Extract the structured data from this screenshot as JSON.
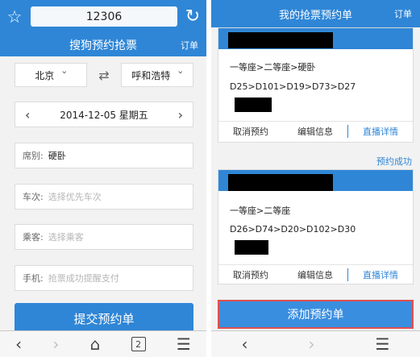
{
  "left": {
    "url": "12306",
    "title": "搜狗预约抢票",
    "title_side": "订单",
    "from_city": "北京",
    "to_city": "呼和浩特",
    "date": "2014-12-05 星期五",
    "fields": {
      "seat_label": "席别:",
      "seat_value": "硬卧",
      "train_label": "车次:",
      "train_placeholder": "选择优先车次",
      "passenger_label": "乘客:",
      "passenger_placeholder": "选择乘客",
      "phone_label": "手机:",
      "phone_placeholder": "抢票成功提醒支付"
    },
    "submit_label": "提交预约单",
    "tab_count": "2"
  },
  "right": {
    "title": "我的抢票预约单",
    "title_side": "订单",
    "cards": [
      {
        "seats": "一等座>二等座>硬卧",
        "trains": "D25>D101>D19>D73>D27"
      },
      {
        "seats": "一等座>二等座",
        "trains": "D26>D74>D20>D102>D30"
      }
    ],
    "actions": {
      "cancel": "取消预约",
      "edit": "编辑信息",
      "live": "直播详情"
    },
    "success_label": "预约成功",
    "add_label": "添加预约单"
  }
}
